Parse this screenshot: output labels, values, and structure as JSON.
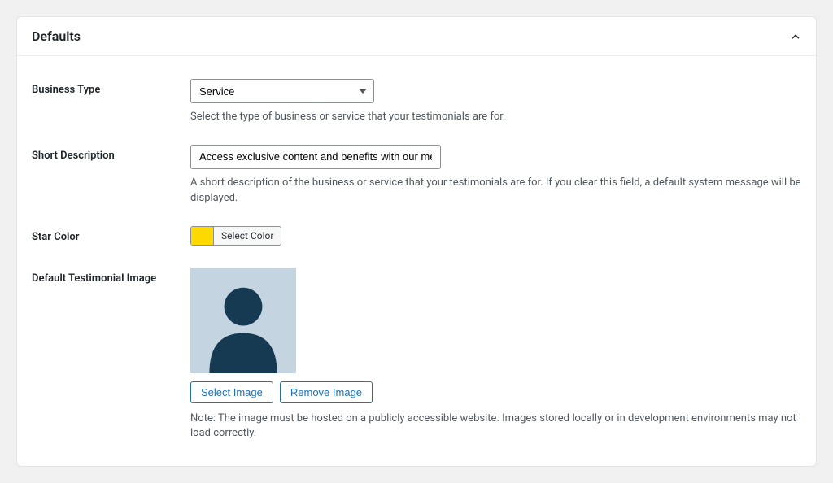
{
  "panel": {
    "title": "Defaults"
  },
  "fields": {
    "business_type": {
      "label": "Business Type",
      "value": "Service",
      "help": "Select the type of business or service that your testimonials are for."
    },
    "short_description": {
      "label": "Short Description",
      "value": "Access exclusive content and benefits with our membership",
      "help": "A short description of the business or service that your testimonials are for. If you clear this field, a default system message will be displayed."
    },
    "star_color": {
      "label": "Star Color",
      "button_label": "Select Color",
      "value": "#ffd900"
    },
    "default_image": {
      "label": "Default Testimonial Image",
      "select_label": "Select Image",
      "remove_label": "Remove Image",
      "help": "Note: The image must be hosted on a publicly accessible website. Images stored locally or in development environments may not load correctly."
    }
  }
}
